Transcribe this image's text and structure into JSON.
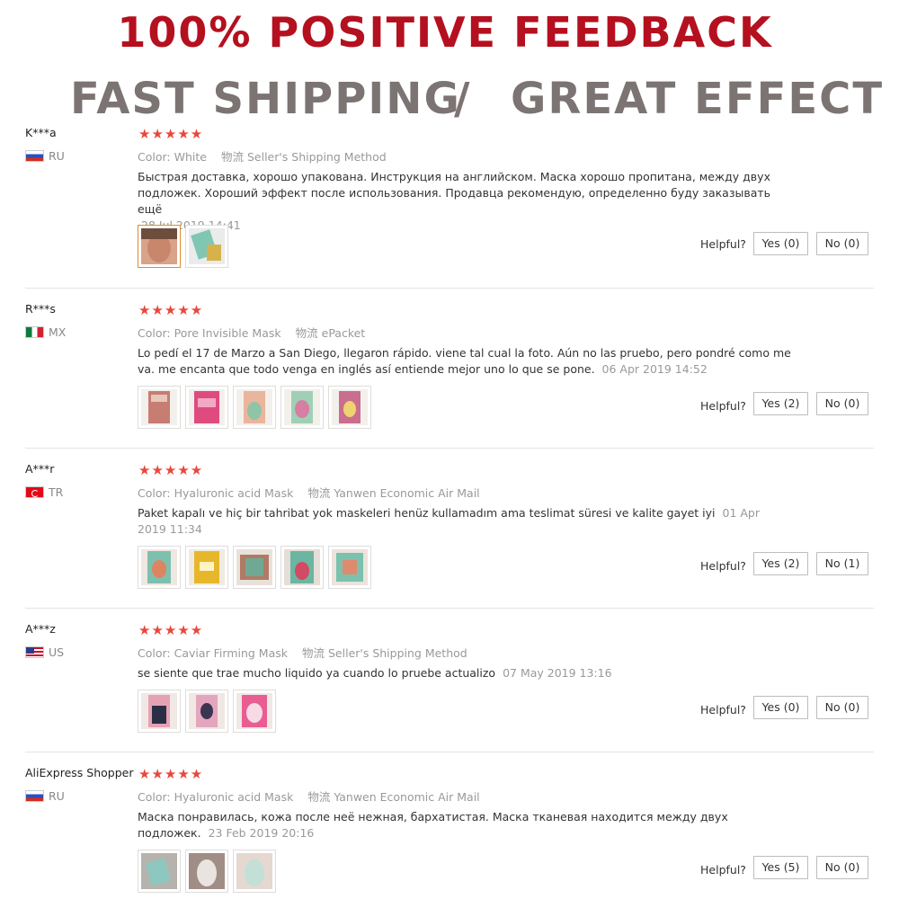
{
  "banner": {
    "line1": "100% POSITIVE FEEDBACK",
    "line2_left": "FAST SHIPPING",
    "line2_sep": "/",
    "line2_right": "GREAT EFFECT"
  },
  "labels": {
    "color": "Color:",
    "logistics": "物流",
    "helpful": "Helpful?"
  },
  "reviews": [
    {
      "user": "K***a",
      "country": "RU",
      "stars": "★★★★★",
      "color": "White",
      "shipping": "Seller's Shipping Method",
      "text": "Быстрая доставка, хорошо упакована. Инструкция на английском. Маска хорошо пропитана, между двух подложек. Хороший эффект после использования. Продавца рекомендую, определенно буду заказывать ещё",
      "date": "28 Jul 2019 14:41",
      "yes": "Yes (0)",
      "no": "No (0)"
    },
    {
      "user": "R***s",
      "country": "MX",
      "stars": "★★★★★",
      "color": "Pore Invisible Mask",
      "shipping": "ePacket",
      "text": "Lo pedí el 17 de Marzo a San Diego, llegaron rápido. viene tal cual la foto. Aún no las pruebo, pero pondré como me va. me encanta que todo venga en inglés así entiende mejor uno lo que se pone.",
      "date": "06 Apr 2019 14:52",
      "yes": "Yes (2)",
      "no": "No (0)"
    },
    {
      "user": "A***r",
      "country": "TR",
      "stars": "★★★★★",
      "color": "Hyaluronic acid Mask",
      "shipping": "Yanwen Economic Air Mail",
      "text": "Paket kapalı ve hiç bir tahribat yok maskeleri henüz kullamadım ama teslimat süresi ve kalite gayet iyi",
      "date": "01 Apr 2019 11:34",
      "yes": "Yes (2)",
      "no": "No (1)"
    },
    {
      "user": "A***z",
      "country": "US",
      "stars": "★★★★★",
      "color": "Caviar Firming Mask",
      "shipping": "Seller's Shipping Method",
      "text": "se siente que trae mucho liquido ya cuando lo pruebe actualizo",
      "date": "07 May 2019 13:16",
      "yes": "Yes (0)",
      "no": "No (0)"
    },
    {
      "user": "AliExpress Shopper",
      "country": "RU",
      "stars": "★★★★★",
      "color": "Hyaluronic acid Mask",
      "shipping": "Yanwen Economic Air Mail",
      "text": "Маска понравилась, кожа после неё нежная, бархатистая. Маска тканевая находится между двух подложек.",
      "date": "23 Feb 2019 20:16",
      "yes": "Yes (5)",
      "no": "No (0)"
    }
  ]
}
